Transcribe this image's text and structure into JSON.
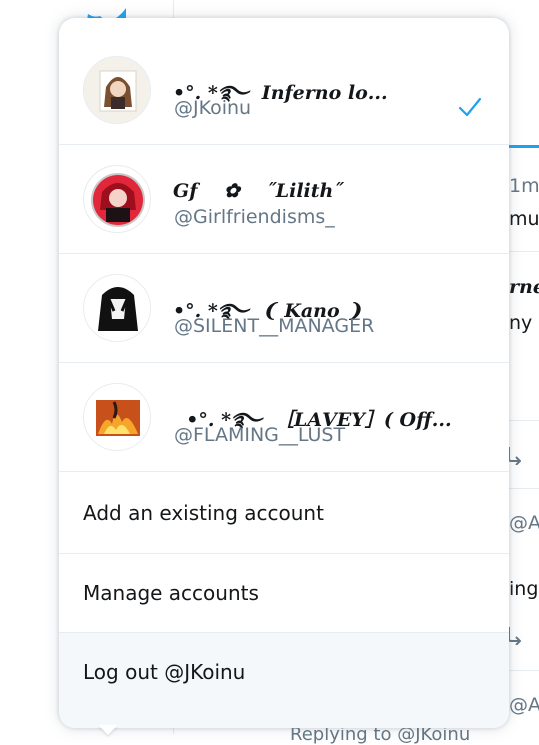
{
  "background": {
    "time_label": "1m",
    "snip_mu": "mu",
    "snip_rne": "rne",
    "snip_ny": "ny",
    "snip_at1": "@A",
    "snip_ing": "ing",
    "snip_at2": "@A",
    "snip_bottom": "Replying to @JKoinu"
  },
  "accounts": [
    {
      "display_name": "•°. *࿐  𝑰𝒏𝒇𝒆𝒓𝒏𝒐 𝒍𝒐...",
      "handle": "@JKoinu",
      "selected": true,
      "avatar_icon": "anime-girl-brown-hair"
    },
    {
      "display_name": "𝑮𝒇    ✿    ˝𝑳𝒊𝒍𝒊𝒕𝒉˝",
      "handle": "@Girlfriendisms_",
      "selected": false,
      "avatar_icon": "anime-girl-red-hair"
    },
    {
      "display_name": "•°. *࿐  ❨ 𝑲𝒂𝒏𝒐 ❩",
      "handle": "@SILENT__MANAGER",
      "selected": false,
      "avatar_icon": "anime-girl-black-hair"
    },
    {
      "display_name": "  •°. *࿐  ［𝑳𝑨𝑽𝑬𝒀］( Off...",
      "handle": "@FLAMING__LUST",
      "selected": false,
      "avatar_icon": "fire-art"
    }
  ],
  "actions": {
    "add_account": "Add an existing account",
    "manage_accounts": "Manage accounts",
    "logout": "Log out @JKoinu"
  },
  "colors": {
    "accent": "#1da1f2",
    "text_primary": "#14171a",
    "text_secondary": "#657786",
    "divider": "#e6ecf0",
    "hover_bg": "#f5f8fa"
  }
}
